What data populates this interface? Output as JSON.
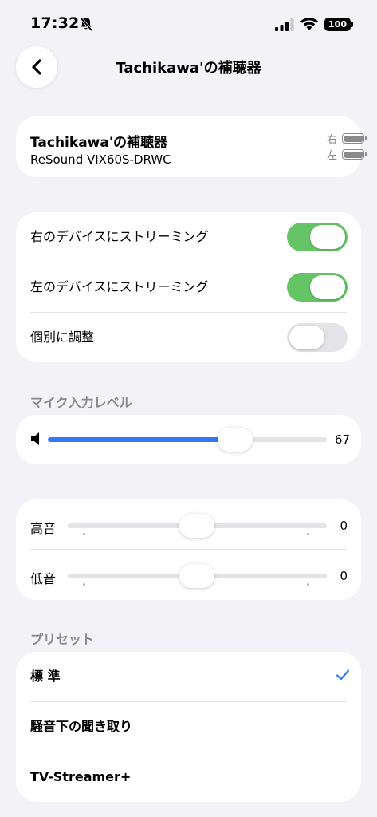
{
  "status_bar": {
    "time": "17:32",
    "battery": "100",
    "icons": [
      "bell-muted-icon",
      "cellular-signal-icon",
      "wifi-icon",
      "battery-icon"
    ]
  },
  "nav": {
    "back_icon": "chevron-left-icon",
    "title": "Tachikawa'の補聴器"
  },
  "device": {
    "name": "Tachikawa'の補聴器",
    "model": "ReSound VIX60S-DRWC",
    "right_label": "右",
    "left_label": "左"
  },
  "streaming": {
    "items": [
      {
        "label": "右のデバイスにストリーミング",
        "on": true
      },
      {
        "label": "左のデバイスにストリーミング",
        "on": true
      },
      {
        "label": "個別に調整",
        "on": false
      }
    ]
  },
  "mic": {
    "header": "マイク入力レベル",
    "value": "67",
    "level_fraction": 0.67,
    "icon": "speaker-icon"
  },
  "eq": {
    "treble_label": "高音",
    "treble_value": "0",
    "bass_label": "低音",
    "bass_value": "0"
  },
  "presets": {
    "header": "プリセット",
    "items": [
      {
        "label": "標 準",
        "selected": true
      },
      {
        "label": "騒音下の聞き取り",
        "selected": false
      },
      {
        "label": "TV-Streamer+",
        "selected": false
      }
    ]
  },
  "colors": {
    "accent": "#3478f6",
    "toggle_on": "#65c466",
    "background": "#f2f2f7"
  }
}
